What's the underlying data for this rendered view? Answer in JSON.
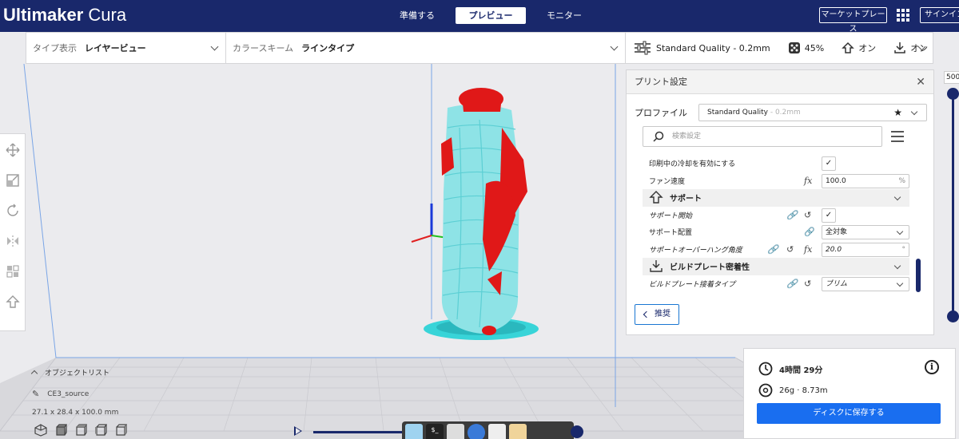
{
  "app": {
    "logo_bold": "Ultimaker",
    "logo_light": "Cura",
    "stages": [
      "準備する",
      "プレビュー",
      "モニター"
    ],
    "active_stage": "プレビュー",
    "marketplace": "マーケットプレース",
    "signin": "サインイン",
    "accent": "#19286b",
    "save_color": "#196ef0"
  },
  "header": {
    "view_type_label": "タイプ表示",
    "view_type_value": "レイヤービュー",
    "color_scheme_label": "カラースキーム",
    "color_scheme_value": "ラインタイプ",
    "quality": "Standard Quality - 0.2mm",
    "infill": "45%",
    "support": "オン",
    "adhesion": "オン"
  },
  "panel": {
    "title": "プリント設定",
    "profile_label": "プロファイル",
    "profile_name": "Standard Quality",
    "profile_suffix": " - 0.2mm",
    "search_placeholder": "検索設定",
    "recommend_button": "推奨",
    "settings": {
      "cooling_enable": "印刷中の冷却を有効にする",
      "fan_speed_label": "ファン速度",
      "fan_speed_value": "100.0",
      "fan_speed_unit": "%",
      "support_category": "サポート",
      "support_start": "サポート開始",
      "support_placement_label": "サポート配置",
      "support_placement_value": "全対象",
      "overhang_label": "サポートオーバーハング角度",
      "overhang_value": "20.0",
      "overhang_unit": "°",
      "adhesion_category": "ビルドプレート密着性",
      "adhesion_type_label": "ビルドプレート接着タイプ",
      "adhesion_type_value": "ブリム"
    }
  },
  "layer_slider": {
    "value": "500"
  },
  "object_list": {
    "title": "オブジェクトリスト",
    "file": "CE3_source",
    "size": "27.1 x 28.4 x 100.0 mm"
  },
  "output": {
    "time": "4時間 29分",
    "material": "26g · 8.73m",
    "save_button": "ディスクに保存する"
  }
}
